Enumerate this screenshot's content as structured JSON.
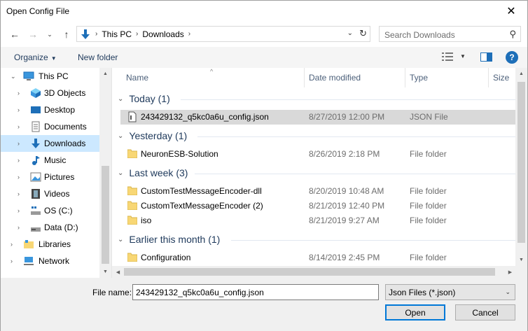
{
  "window": {
    "title": "Open Config File",
    "close_glyph": "✕"
  },
  "nav": {
    "back": "←",
    "forward": "→",
    "recent": "⌄",
    "up": "↑",
    "breadcrumbs": [
      "This PC",
      "Downloads"
    ],
    "refresh": "↻",
    "search_placeholder": "Search Downloads",
    "search_glyph": "⚲"
  },
  "toolbar": {
    "organize": "Organize",
    "new_folder": "New folder",
    "help": "?"
  },
  "tree": [
    {
      "label": "This PC",
      "icon": "pc-icon",
      "expanded": true
    },
    {
      "label": "3D Objects",
      "icon": "3d-objects-icon"
    },
    {
      "label": "Desktop",
      "icon": "desktop-icon"
    },
    {
      "label": "Documents",
      "icon": "documents-icon"
    },
    {
      "label": "Downloads",
      "icon": "downloads-icon",
      "selected": true
    },
    {
      "label": "Music",
      "icon": "music-icon"
    },
    {
      "label": "Pictures",
      "icon": "pictures-icon"
    },
    {
      "label": "Videos",
      "icon": "videos-icon"
    },
    {
      "label": "OS (C:)",
      "icon": "drive-c-icon"
    },
    {
      "label": "Data (D:)",
      "icon": "drive-d-icon"
    },
    {
      "label": "Libraries",
      "icon": "libraries-icon"
    },
    {
      "label": "Network",
      "icon": "network-icon"
    }
  ],
  "columns": {
    "name": "Name",
    "date": "Date modified",
    "type": "Type",
    "size": "Size"
  },
  "groups": [
    {
      "title": "Today (1)",
      "rows": [
        {
          "name": "243429132_q5kc0a6u_config.json",
          "date": "8/27/2019 12:00 PM",
          "type": "JSON File",
          "kind": "file",
          "selected": true
        }
      ]
    },
    {
      "title": "Yesterday (1)",
      "rows": [
        {
          "name": "NeuronESB-Solution",
          "date": "8/26/2019 2:18 PM",
          "type": "File folder",
          "kind": "folder"
        }
      ]
    },
    {
      "title": "Last week (3)",
      "rows": [
        {
          "name": "CustomTestMessageEncoder-dll",
          "date": "8/20/2019 10:48 AM",
          "type": "File folder",
          "kind": "folder"
        },
        {
          "name": "CustomTextMessageEncoder (2)",
          "date": "8/21/2019 12:40 PM",
          "type": "File folder",
          "kind": "folder"
        },
        {
          "name": "iso",
          "date": "8/21/2019 9:27 AM",
          "type": "File folder",
          "kind": "folder"
        }
      ]
    },
    {
      "title": "Earlier this month (1)",
      "rows": [
        {
          "name": "Configuration",
          "date": "8/14/2019 2:45 PM",
          "type": "File folder",
          "kind": "folder"
        }
      ]
    }
  ],
  "bottom": {
    "file_name_label": "File name:",
    "file_name_value": "243429132_q5kc0a6u_config.json",
    "filter": "Json Files (*.json)",
    "open": "Open",
    "cancel": "Cancel"
  },
  "colors": {
    "accent": "#0078d7",
    "selected_tree": "#cce8ff",
    "selected_row": "#d9d9d9",
    "group_text": "#1e395b",
    "folder": "#f8d775"
  }
}
